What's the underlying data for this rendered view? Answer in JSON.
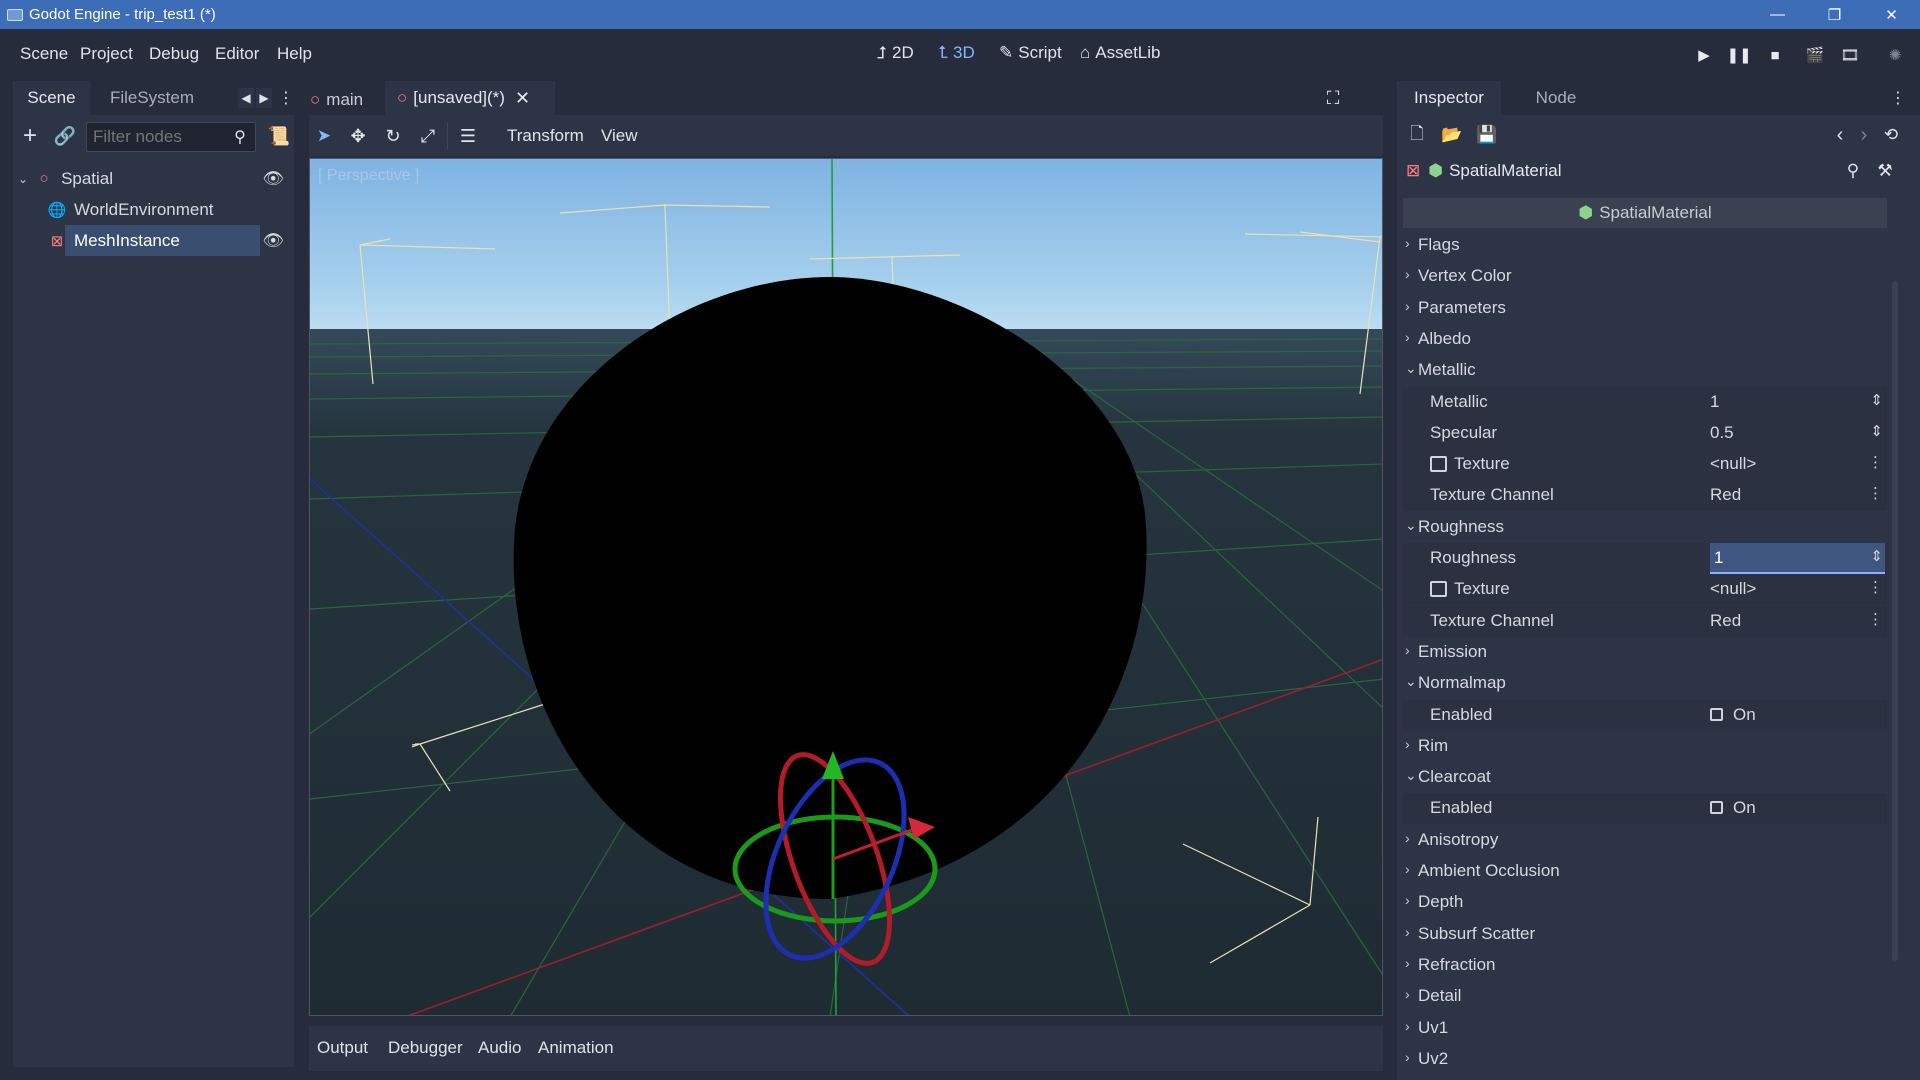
{
  "window": {
    "title": "Godot Engine - trip_test1 (*)",
    "controls": [
      "—",
      "❐",
      "✕"
    ]
  },
  "menu": [
    "Scene",
    "Project",
    "Debug",
    "Editor",
    "Help"
  ],
  "workspaces": [
    {
      "label": "2D",
      "icon": "2d-icon"
    },
    {
      "label": "3D",
      "icon": "3d-icon",
      "active": true
    },
    {
      "label": "Script",
      "icon": "script-icon"
    },
    {
      "label": "AssetLib",
      "icon": "assetlib-icon"
    }
  ],
  "left_dock": {
    "tabs": [
      "Scene",
      "FileSystem"
    ],
    "filter_placeholder": "Filter nodes",
    "tree": [
      {
        "label": "Spatial",
        "icon": "spatial-icon",
        "visible": true
      },
      {
        "label": "WorldEnvironment",
        "icon": "world-environment-icon"
      },
      {
        "label": "MeshInstance",
        "icon": "mesh-instance-icon",
        "selected": true,
        "visible": true
      }
    ]
  },
  "scene_tabs": [
    {
      "label": "main"
    },
    {
      "label": "[unsaved](*)",
      "active": true
    }
  ],
  "viewport": {
    "toolbar": {
      "transform_menu": "Transform",
      "view_menu": "View"
    },
    "camera_label": "[ Perspective ]",
    "colors": {
      "sky_top": "#7fb3e2",
      "sky_horizon": "#a9d2ee",
      "ground": "#1f2b33",
      "grid": "#2b6b3a",
      "sphere": "#000000"
    }
  },
  "bottom_panel": [
    "Output",
    "Debugger",
    "Audio",
    "Animation"
  ],
  "inspector": {
    "tabs": [
      "Inspector",
      "Node"
    ],
    "resource_name": "SpatialMaterial",
    "header": "SpatialMaterial",
    "rows": [
      {
        "type": "section",
        "label": "Flags",
        "open": false
      },
      {
        "type": "section",
        "label": "Vertex Color",
        "open": false
      },
      {
        "type": "section",
        "label": "Parameters",
        "open": false
      },
      {
        "type": "section",
        "label": "Albedo",
        "open": false
      },
      {
        "type": "section",
        "label": "Metallic",
        "open": true
      },
      {
        "type": "prop",
        "label": "Metallic",
        "value": "1",
        "control": "spin"
      },
      {
        "type": "prop",
        "label": "Specular",
        "value": "0.5",
        "control": "spin"
      },
      {
        "type": "prop",
        "label": "Texture",
        "value": "<null>",
        "control": "menu",
        "icon": true
      },
      {
        "type": "prop",
        "label": "Texture Channel",
        "value": "Red",
        "control": "menu"
      },
      {
        "type": "section",
        "label": "Roughness",
        "open": true
      },
      {
        "type": "prop",
        "label": "Roughness",
        "value": "1",
        "control": "spin",
        "editing": true
      },
      {
        "type": "prop",
        "label": "Texture",
        "value": "<null>",
        "control": "menu",
        "icon": true
      },
      {
        "type": "prop",
        "label": "Texture Channel",
        "value": "Red",
        "control": "menu"
      },
      {
        "type": "section",
        "label": "Emission",
        "open": false
      },
      {
        "type": "section",
        "label": "Normalmap",
        "open": true
      },
      {
        "type": "prop",
        "label": "Enabled",
        "value": "On",
        "control": "check"
      },
      {
        "type": "section",
        "label": "Rim",
        "open": false
      },
      {
        "type": "section",
        "label": "Clearcoat",
        "open": true
      },
      {
        "type": "prop",
        "label": "Enabled",
        "value": "On",
        "control": "check"
      },
      {
        "type": "section",
        "label": "Anisotropy",
        "open": false
      },
      {
        "type": "section",
        "label": "Ambient Occlusion",
        "open": false
      },
      {
        "type": "section",
        "label": "Depth",
        "open": false
      },
      {
        "type": "section",
        "label": "Subsurf Scatter",
        "open": false
      },
      {
        "type": "section",
        "label": "Refraction",
        "open": false
      },
      {
        "type": "section",
        "label": "Detail",
        "open": false
      },
      {
        "type": "section",
        "label": "Uv1",
        "open": false
      },
      {
        "type": "section",
        "label": "Uv2",
        "open": false
      }
    ]
  }
}
